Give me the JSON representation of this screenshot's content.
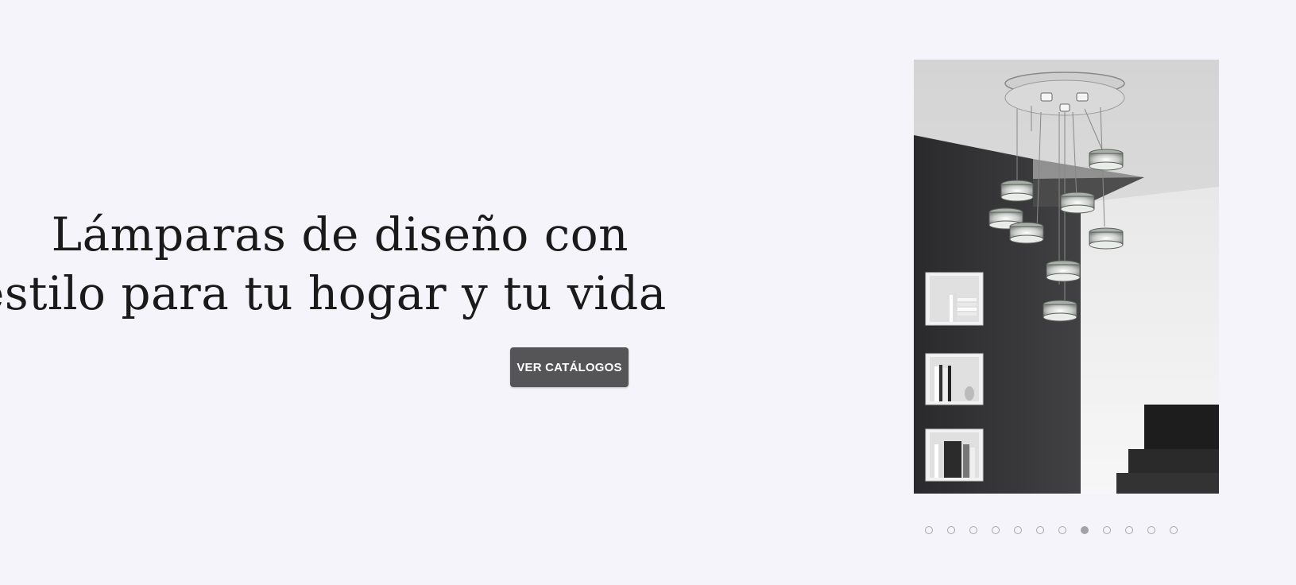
{
  "hero": {
    "headline_line1": "Lámparas de diseño con",
    "headline_line2": "estilo para tu hogar y tu vida",
    "cta_label": "VER CATÁLOGOS"
  },
  "carousel": {
    "slide_count": 12,
    "active_index": 7
  },
  "colors": {
    "background": "#f5f4fa",
    "button": "#555457",
    "button_text": "#ffffff",
    "dot_inactive": "#a8a7ad",
    "dot_active": "#a3a2a8"
  }
}
